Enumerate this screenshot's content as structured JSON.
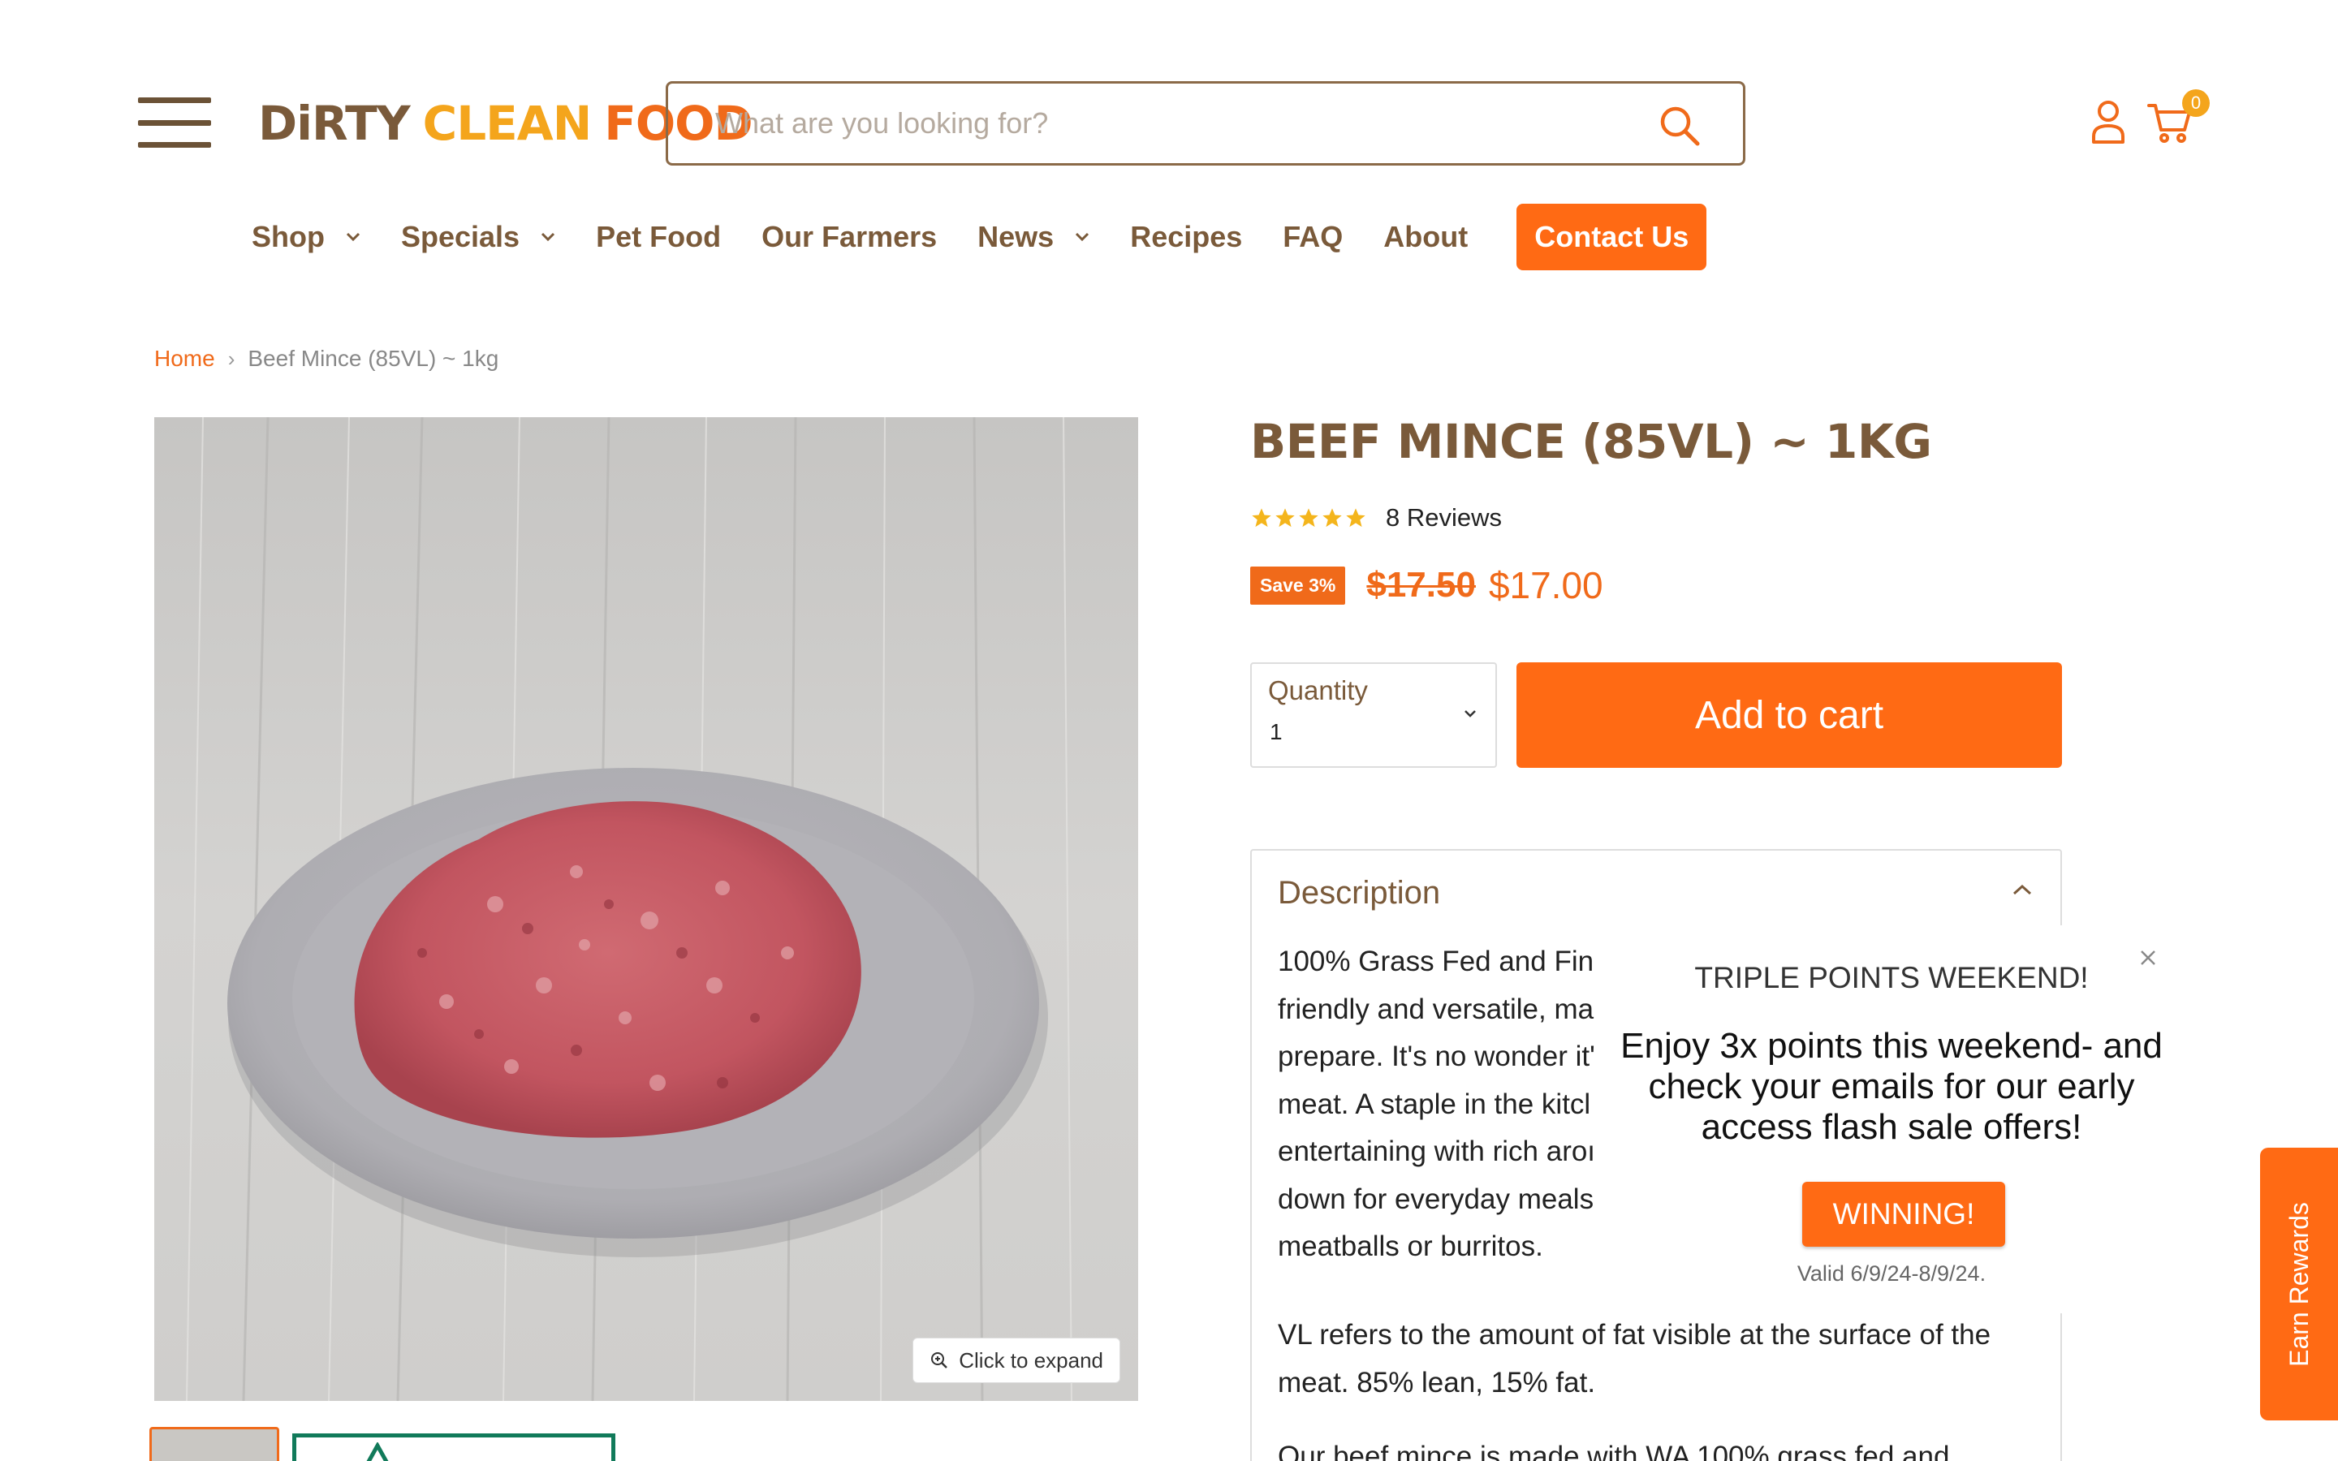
{
  "header": {
    "logo": {
      "word1": "DiRTY",
      "word2": "CLEAN",
      "word3": "FOOD"
    },
    "search_placeholder": "What are you looking for?",
    "cart_count": "0"
  },
  "nav": {
    "items": [
      {
        "label": "Shop",
        "dropdown": true
      },
      {
        "label": "Specials",
        "dropdown": true
      },
      {
        "label": "Pet Food",
        "dropdown": false
      },
      {
        "label": "Our Farmers",
        "dropdown": false
      },
      {
        "label": "News",
        "dropdown": true
      },
      {
        "label": "Recipes",
        "dropdown": false
      },
      {
        "label": "FAQ",
        "dropdown": false
      },
      {
        "label": "About",
        "dropdown": false
      }
    ],
    "contact_label": "Contact Us"
  },
  "breadcrumb": {
    "home": "Home",
    "separator": "›",
    "current": "Beef Mince (85VL) ~ 1kg"
  },
  "product": {
    "title": "BEEF MINCE (85VL) ~ 1KG",
    "rating": 5,
    "reviews_label": "8 Reviews",
    "save_badge": "Save 3%",
    "old_price": "$17.50",
    "price": "$17.00",
    "quantity_label": "Quantity",
    "quantity_value": "1",
    "add_to_cart": "Add to cart",
    "expand_label": "Click to expand"
  },
  "description": {
    "heading": "Description",
    "p1_lines": [
      "100% Grass Fed and Fin",
      "friendly and versatile, ma",
      "prepare. It's no wonder it'",
      "meat. A staple in the kitcl",
      "entertaining with rich aroı",
      "down for everyday meals",
      "meatballs or burritos."
    ],
    "p2": "VL refers to the amount of fat visible at the surface of the meat. 85% lean, 15% fat.",
    "p3": "Our beef mince is made with WA 100% grass fed and"
  },
  "popup": {
    "title": "TRIPLE POINTS WEEKEND!",
    "body": "Enjoy 3x points this weekend- and check your emails for our early access flash sale offers!",
    "button": "WINNING!",
    "valid": "Valid 6/9/24-8/9/24."
  },
  "rewards_tab": "Earn Rewards",
  "colors": {
    "brand_brown": "#7a5a3a",
    "brand_orange": "#ff6a14",
    "brand_yellow": "#f4a51c"
  }
}
